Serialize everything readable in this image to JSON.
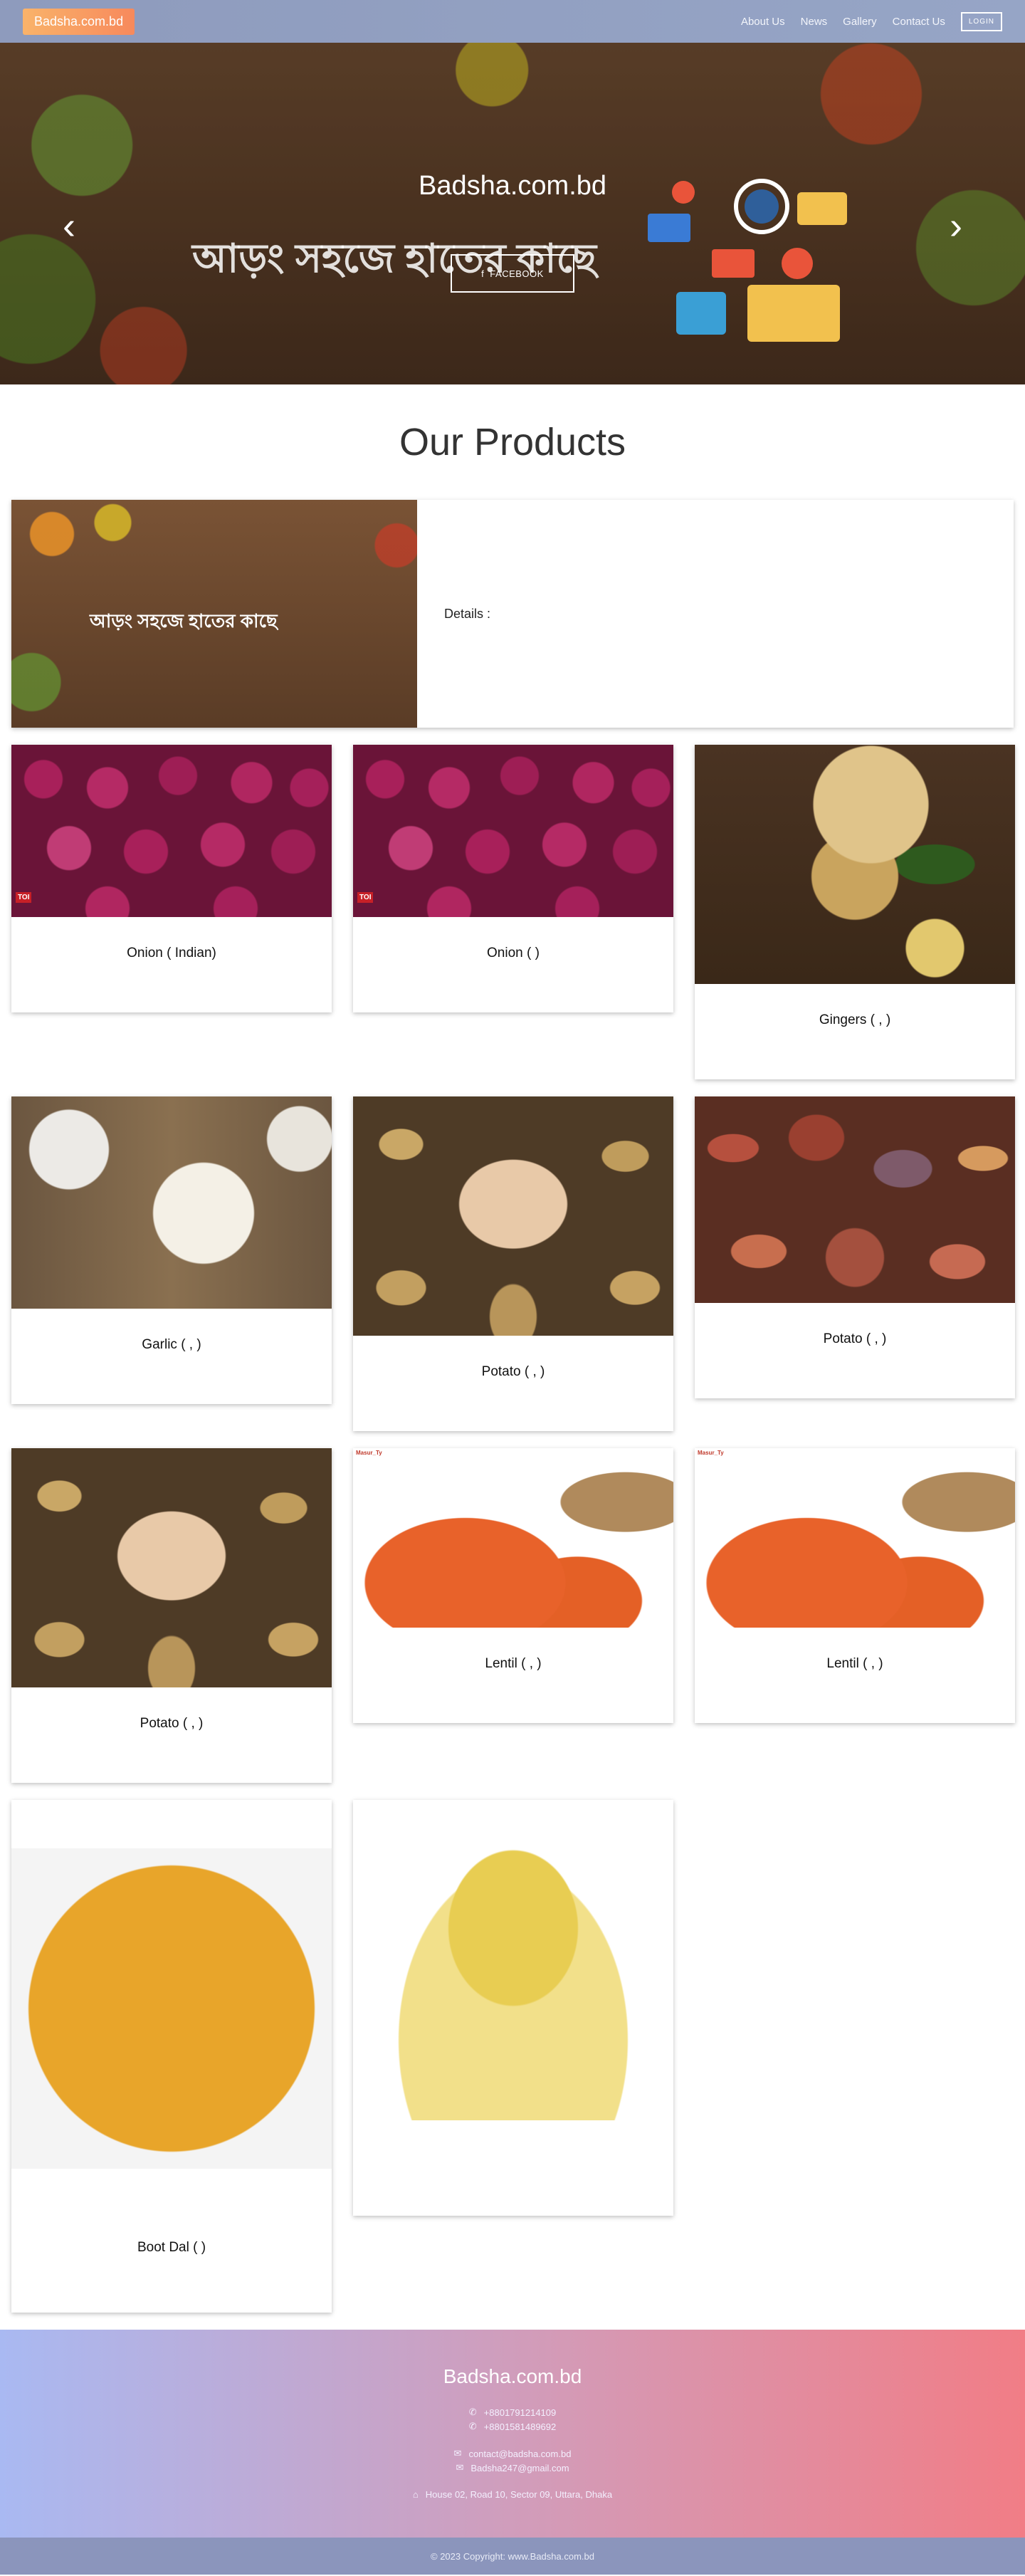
{
  "nav": {
    "brand": "Badsha.com.bd",
    "links": [
      "About Us",
      "News",
      "Gallery",
      "Contact Us"
    ],
    "login": "LOGIN"
  },
  "hero": {
    "logo_text": "আড়ং সহজে হাতের কাছে",
    "title": "Badsha.com.bd",
    "facebook_label": "FACEBOOK",
    "prev_icon": "chevron-left-icon",
    "next_icon": "chevron-right-icon"
  },
  "products": {
    "title": "Our Products",
    "featured": {
      "logo_text": "আড়ং সহজে হাতের কাছে",
      "details_label": "Details :"
    },
    "items": [
      {
        "name": "Onion        ( Indian)",
        "image": "onion",
        "badge": "TOI"
      },
      {
        "name": "Onion        (    )",
        "image": "onion",
        "badge": "TOI"
      },
      {
        "name": "Gingers (     ,          )",
        "image": "ginger"
      },
      {
        "name": "Garlic (     ,      )",
        "image": "garlic"
      },
      {
        "name": "Potato (     ,      )",
        "image": "potato"
      },
      {
        "name": "Potato (        ,      )",
        "image": "redpotato"
      },
      {
        "name": "Potato (     ,      )",
        "image": "potato"
      },
      {
        "name": "Lentil (         ,     )",
        "image": "lentil",
        "badge": "Masur_Ty"
      },
      {
        "name": "Lentil (         ,     )",
        "image": "lentil",
        "badge": "Masur_Ty"
      },
      {
        "name": "Boot Dal (          )",
        "image": "chana"
      },
      {
        "name": "",
        "image": "moong"
      }
    ]
  },
  "footer": {
    "title": "Badsha.com.bd",
    "phones": [
      "+8801791214109",
      "+8801581489692"
    ],
    "emails": [
      "contact@badsha.com.bd",
      "Badsha247@gmail.com"
    ],
    "address": "House 02, Road 10, Sector 09, Uttara, Dhaka",
    "copyright": "© 2023 Copyright: www.Badsha.com.bd"
  }
}
